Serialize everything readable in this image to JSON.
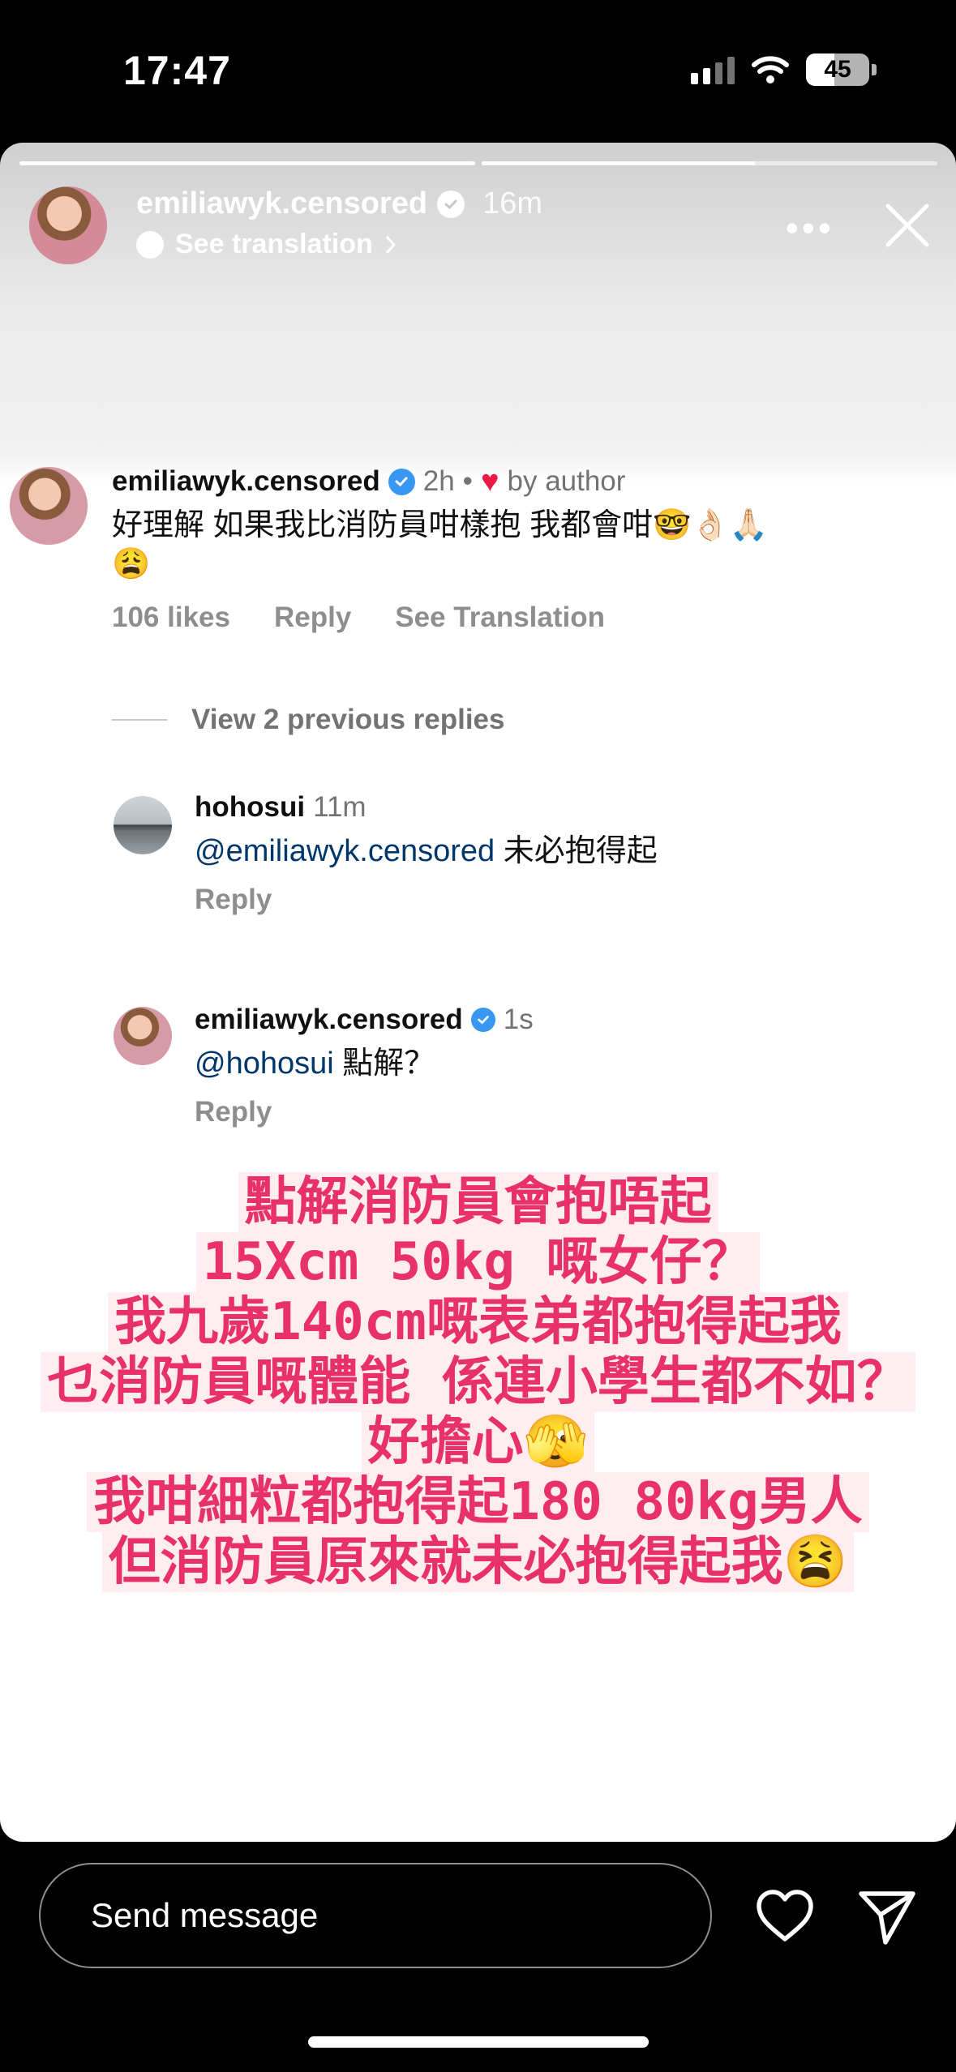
{
  "status_bar": {
    "time": "17:47",
    "battery": "45"
  },
  "story": {
    "username": "emiliawyk.censored",
    "time_ago": "16m",
    "translate_label": "See translation",
    "progress": [
      1.0,
      0.6
    ]
  },
  "comment": {
    "username": "emiliawyk.censored",
    "time_ago": "2h",
    "dot": "•",
    "liked_by_author": "by author",
    "text_line1": "好理解 如果我比消防員咁樣抱 我都會咁🤓👌🏻🙏🏻",
    "text_line2": "😩",
    "likes": "106 likes",
    "reply_label": "Reply",
    "translation_label": "See Translation"
  },
  "view_replies": "View 2 previous replies",
  "replies": [
    {
      "username": "hohosui",
      "time_ago": "11m",
      "mention": "@emiliawyk.censored",
      "text": " 未必抱得起",
      "reply_label": "Reply"
    },
    {
      "username": "emiliawyk.censored",
      "time_ago": "1s",
      "mention": "@hohosui",
      "text": " 點解？",
      "reply_label": "Reply"
    }
  ],
  "caption_lines": [
    "點解消防員會抱唔起",
    "15Xcm 50kg 嘅女仔？",
    "我九歲140cm嘅表弟都抱得起我",
    "乜消防員嘅體能 係連小學生都不如？",
    "好擔心🫣",
    "我咁細粒都抱得起180 80kg男人",
    "但消防員原來就未必抱得起我😫"
  ],
  "bottom": {
    "message_placeholder": "Send message"
  },
  "colors": {
    "caption_text": "#e8316c",
    "caption_bg": "#ffecf0",
    "verified": "#3897f0",
    "heart": "#ed1944",
    "mention": "#00376b"
  }
}
